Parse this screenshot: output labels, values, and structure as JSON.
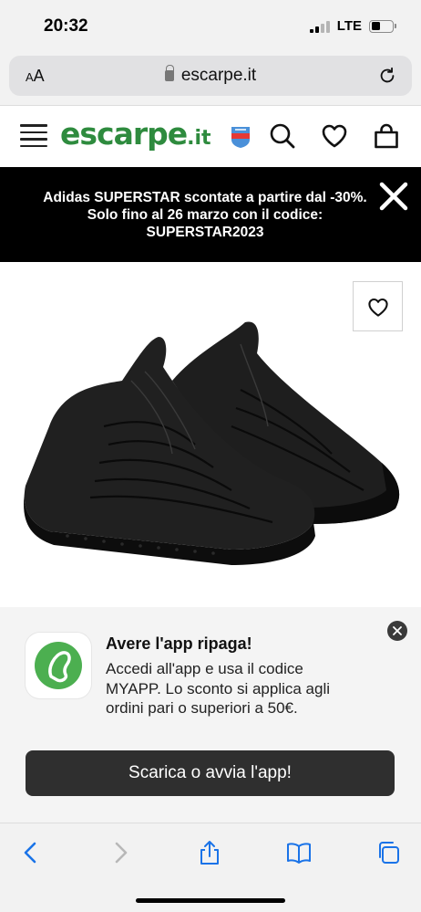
{
  "status_bar": {
    "time": "20:32",
    "network": "LTE",
    "battery_level": 0.45
  },
  "browser": {
    "text_size_label": "AA",
    "url": "escarpe.it",
    "reload_icon": "reload-icon",
    "lock_icon": "lock-icon"
  },
  "site_header": {
    "logo_text": "escarpe",
    "logo_suffix": ".it",
    "icons": [
      "menu-icon",
      "badge-icon",
      "search-icon",
      "heart-icon",
      "bag-icon"
    ],
    "brand_color": "#2e8b3e"
  },
  "promo": {
    "text": "Adidas SUPERSTAR scontate a partire dal -30%. Solo fino al 26 marzo con il codice: SUPERSTAR2023",
    "close_icon": "close-icon"
  },
  "product": {
    "wishlist_icon": "heart-icon"
  },
  "app_banner": {
    "title": "Avere l'app ripaga!",
    "description": "Accedi all'app e usa il codice MYAPP. Lo sconto si applica agli ordini pari o superiori a 50€.",
    "cta_label": "Scarica o avvia l'app!",
    "close_icon": "close-icon",
    "app_icon": "app-logo-icon"
  },
  "toolbar": {
    "icons": [
      "back-icon",
      "forward-icon",
      "share-icon",
      "bookmarks-icon",
      "tabs-icon"
    ],
    "accent_color": "#1a73e8"
  }
}
